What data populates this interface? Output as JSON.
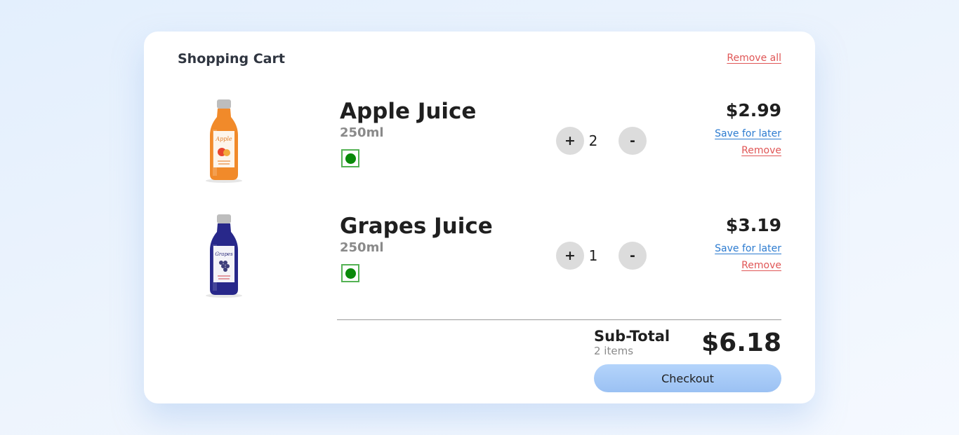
{
  "cart": {
    "title": "Shopping Cart",
    "remove_all": "Remove all",
    "items": [
      {
        "name": "Apple Juice",
        "volume": "250ml",
        "quantity": "2",
        "price": "$2.99",
        "save_for_later": "Save for later",
        "remove": "Remove",
        "plus": "+",
        "minus": "-",
        "bottle_color": "#f18a2a",
        "cap_color": "#bdbdbd",
        "label_text": "Apple"
      },
      {
        "name": "Grapes Juice",
        "volume": "250ml",
        "quantity": "1",
        "price": "$3.19",
        "save_for_later": "Save for later",
        "remove": "Remove",
        "plus": "+",
        "minus": "-",
        "bottle_color": "#28288a",
        "cap_color": "#bdbdbd",
        "label_text": "Grapes"
      }
    ],
    "subtotal": {
      "label": "Sub-Total",
      "count": "2 items",
      "amount": "$6.18"
    },
    "checkout_label": "Checkout"
  },
  "colors": {
    "accent_blue": "#2c7bd0",
    "danger_red": "#e05656",
    "veg_green": "#0a8a0a",
    "checkout_bg": "#9bc1f3"
  }
}
